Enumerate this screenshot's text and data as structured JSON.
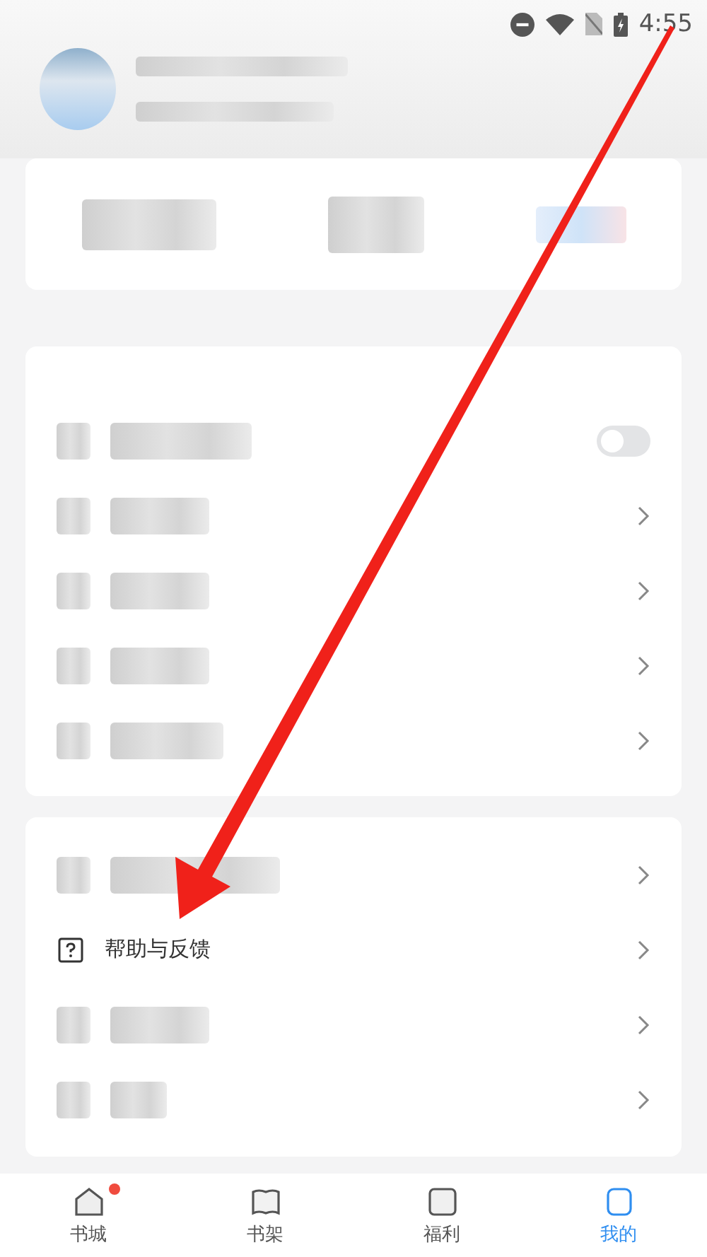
{
  "status_bar": {
    "time": "4:55"
  },
  "menu_groups": [
    {
      "items": [
        {
          "kind": "blurred",
          "on": false
        },
        {
          "kind": "blurred"
        },
        {
          "kind": "blurred"
        },
        {
          "kind": "blurred"
        },
        {
          "kind": "blurred"
        }
      ]
    },
    {
      "items": [
        {
          "kind": "blurred"
        },
        {
          "kind": "text",
          "label": "帮助与反馈"
        },
        {
          "kind": "blurred"
        },
        {
          "kind": "blurred"
        }
      ]
    }
  ],
  "tabs": [
    {
      "label": "书城",
      "selected": false,
      "badge": true
    },
    {
      "label": "书架",
      "selected": false,
      "badge": false
    },
    {
      "label": "福利",
      "selected": false,
      "badge": false
    },
    {
      "label": "我的",
      "selected": true,
      "badge": false
    }
  ]
}
